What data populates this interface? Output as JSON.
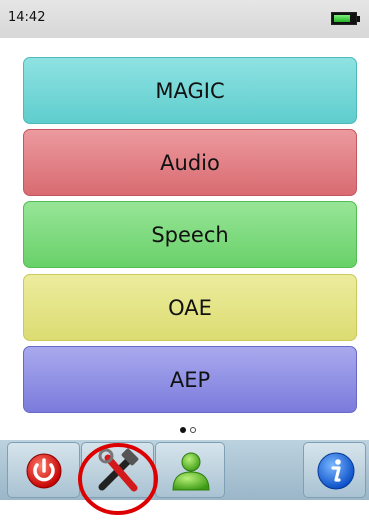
{
  "status": {
    "time": "14:42",
    "battery_level_percent": 80,
    "battery_icon": "battery-icon"
  },
  "menu": {
    "items": [
      {
        "label": "MAGIC",
        "color": "#6fd6d6"
      },
      {
        "label": "Audio",
        "color": "#e17f84"
      },
      {
        "label": "Speech",
        "color": "#7cd97c"
      },
      {
        "label": "OAE",
        "color": "#e3e385"
      },
      {
        "label": "AEP",
        "color": "#8f8fe4"
      }
    ]
  },
  "pagination": {
    "current_page": 1,
    "total_pages": 2
  },
  "toolbar": {
    "buttons": [
      {
        "icon": "power-icon"
      },
      {
        "icon": "tools-icon",
        "highlighted": true
      },
      {
        "icon": "user-icon"
      },
      {
        "icon": "info-icon"
      }
    ],
    "highlight_color": "#dd0000"
  }
}
